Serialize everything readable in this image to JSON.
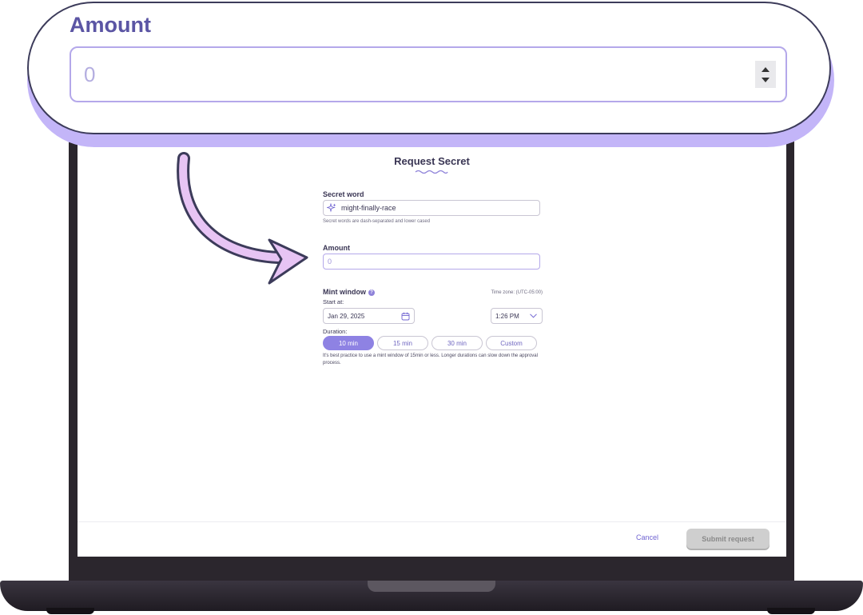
{
  "callout": {
    "label": "Amount",
    "value": "0"
  },
  "form": {
    "title": "Request Secret",
    "secret_word": {
      "label": "Secret word",
      "value": "might-finally-race",
      "helper": "Secret words are dash-separated and lower cased"
    },
    "amount": {
      "label": "Amount",
      "placeholder": "0"
    },
    "mint_window": {
      "label": "Mint window",
      "info_icon": "question-icon",
      "timezone": "Time zone: (UTC-05:00)",
      "start_label": "Start at:",
      "date": "Jan 29, 2025",
      "time": "1:26 PM",
      "duration_label": "Duration:",
      "durations": [
        "10 min",
        "15 min",
        "30 min",
        "Custom"
      ],
      "selected_duration": "10 min",
      "helper": "It's best practice to use a mint window of 15min or less. Longer durations can slow down the approval process."
    }
  },
  "footer": {
    "cancel_label": "Cancel",
    "submit_label": "Submit request"
  },
  "colors": {
    "accent": "#8e82e3",
    "callout_shadow": "#c3b5f8",
    "heading": "#3a3654"
  }
}
